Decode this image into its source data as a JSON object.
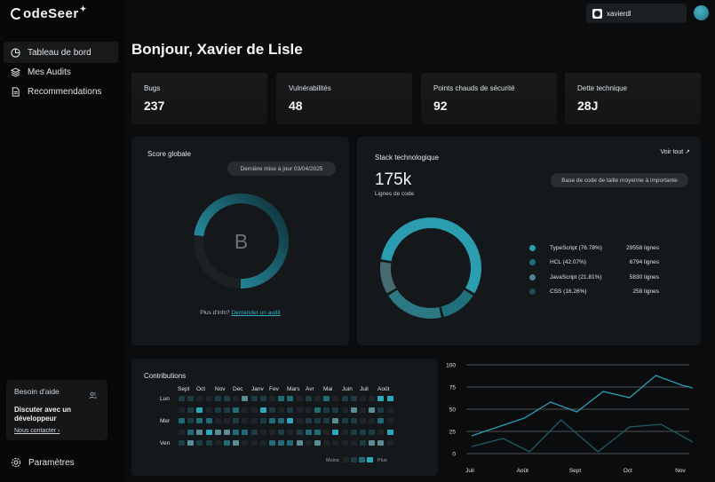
{
  "app": {
    "logo": "odeSeer",
    "logo_spark": "✦"
  },
  "sidebar": {
    "items": [
      {
        "label": "Tableau de bord",
        "icon": "dashboard-icon",
        "active": true
      },
      {
        "label": "Mes Audits",
        "icon": "layers-icon",
        "active": false
      },
      {
        "label": "Recommendations",
        "icon": "document-icon",
        "active": false
      }
    ],
    "help": {
      "title": "Besoin d'aide",
      "description": "Discuter avec un développeur",
      "link": "Nous contacter"
    },
    "settings": "Paramètres"
  },
  "header": {
    "username": "xavierdl",
    "greeting": "Bonjour, Xavier de Lisle"
  },
  "stats": [
    {
      "label": "Bugs",
      "value": "237"
    },
    {
      "label": "Vulnérabilités",
      "value": "48"
    },
    {
      "label": "Points chauds de sécurité",
      "value": "92"
    },
    {
      "label": "Dette technique",
      "value": "28J"
    }
  ],
  "score": {
    "title": "Score globale",
    "updated": "Dernière mise à jour 03/04/2025",
    "grade": "B",
    "progress": 0.73,
    "footer_text": "Plus d'info?",
    "footer_link": "Demander un audit"
  },
  "stack": {
    "title": "Stack technologique",
    "see_all": "Voir tout",
    "total": "175k",
    "total_label": "Lignes de code",
    "badge": "Base de code de taille moyenne à importante",
    "languages": [
      {
        "name": "TypeScript (76.78%)",
        "lines": "29558 lignes",
        "color": "#2a9db1"
      },
      {
        "name": "HCL (42.07%)",
        "lines": "6794 lignes",
        "color": "#1f6f7c"
      },
      {
        "name": "JavaScript (21.81%)",
        "lines": "5830 lignes",
        "color": "#4d8591"
      },
      {
        "name": "CSS (16.26%)",
        "lines": "258 lignes",
        "color": "#214c55"
      }
    ]
  },
  "contributions": {
    "title": "Contributions",
    "months": [
      "Sept",
      "Oct",
      "Nov",
      "Dec",
      "Janv",
      "Fev",
      "Mars",
      "Avr",
      "Mai",
      "Juin",
      "Juil",
      "Août"
    ],
    "days": [
      "Lun",
      "Mer",
      "Ven"
    ],
    "less": "Moins",
    "more": "Plus"
  },
  "chart_data": {
    "type": "line",
    "categories": [
      "Juil",
      "Août",
      "Sept",
      "Oct",
      "Nov"
    ],
    "y_ticks": [
      "100",
      "75",
      "50",
      "25",
      "0"
    ],
    "ylim": [
      0,
      100
    ],
    "grid": true,
    "series": [
      {
        "x": [
          0,
          0.5,
          1,
          1.5,
          2,
          2.5,
          3,
          3.5,
          4,
          4.2
        ],
        "values": [
          20,
          30,
          40,
          58,
          47,
          70,
          63,
          88,
          77,
          74
        ],
        "color": "#2c9fb3"
      },
      {
        "x": [
          0,
          0.6,
          1.1,
          1.7,
          2.4,
          3,
          3.6,
          4.2
        ],
        "values": [
          8,
          17,
          2,
          38,
          2,
          30,
          33,
          13
        ],
        "color": "#1e5c68"
      }
    ]
  }
}
